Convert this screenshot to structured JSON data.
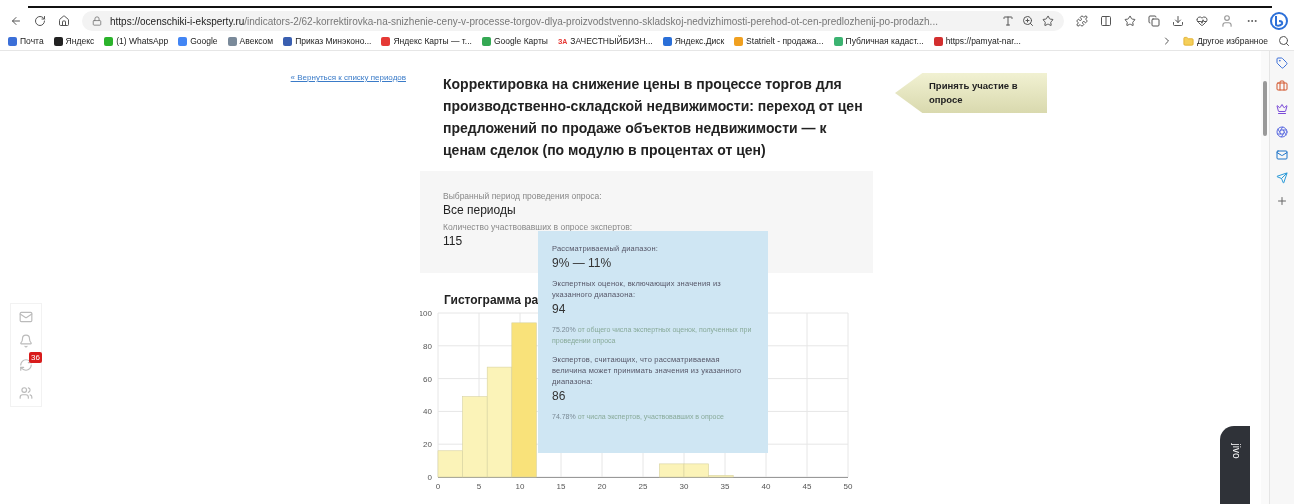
{
  "browser": {
    "url_host": "https://ocenschiki-i-eksperty.ru",
    "url_path": "/indicators-2/62-korrektirovka-na-snizhenie-ceny-v-processe-torgov-dlya-proizvodstvenno-skladskoj-nedvizhimosti-perehod-ot-cen-predlozhenij-po-prodazh...",
    "bookmarks": [
      {
        "label": "Почта",
        "color": "#3b6fd8"
      },
      {
        "label": "Яндекс",
        "color": "#222222"
      },
      {
        "label": "(1) WhatsApp",
        "color": "#2bb32b"
      },
      {
        "label": "Google",
        "color": "#4285f4"
      },
      {
        "label": "Авексом",
        "color": "#7a8a9a"
      },
      {
        "label": "Приказ Минэконо...",
        "color": "#3a5fb0"
      },
      {
        "label": "Яндекс Карты — т...",
        "color": "#e53935"
      },
      {
        "label": "Google Карты",
        "color": "#34a853"
      },
      {
        "label": "ЗАЧЕСТНЫЙБИЗН...",
        "color": "#e53935",
        "icon_text": "ЗА"
      },
      {
        "label": "Яндекс.Диск",
        "color": "#2a6fd8"
      },
      {
        "label": "Statrielt - продажа...",
        "color": "#f0a020"
      },
      {
        "label": "Публичная кадаст...",
        "color": "#3cb371"
      },
      {
        "label": "https://pamyat-nar...",
        "color": "#d32f2f"
      }
    ],
    "other_favorites": "Другое избранное"
  },
  "page": {
    "back_link": "« Вернуться к списку периодов",
    "title": "Корректировка на снижение цены в процессе торгов для производственно-складской недвижимости: переход от цен предложений по продаже объектов недвижимости — к ценам сделок (по модулю в процентах от цен)",
    "cta": "Принять участие в опросе",
    "info": [
      {
        "label": "Выбранный период проведения опроса:",
        "value": "Все периоды"
      },
      {
        "label": "Количество участвовавших в опросе экспертов:",
        "value": "115"
      }
    ],
    "histogram_title": "Гистограмма ра",
    "chart_data": {
      "type": "bar",
      "x": [
        1.5,
        4.5,
        7.5,
        10.5,
        28.5,
        31.5,
        34.5
      ],
      "series": [
        {
          "color": "#fbf3b8",
          "values": [
            16,
            49,
            67,
            null,
            8,
            8,
            1
          ]
        },
        {
          "color": "#f9e27a",
          "values": [
            null,
            null,
            null,
            94,
            null,
            null,
            null
          ]
        }
      ],
      "xlim": [
        0,
        50
      ],
      "ylim": [
        0,
        100
      ],
      "xticks": [
        0,
        5,
        10,
        15,
        20,
        25,
        30,
        35,
        40,
        45,
        50
      ],
      "yticks": [
        0,
        20,
        40,
        60,
        80,
        100
      ],
      "grid": true
    },
    "tooltip": {
      "range_label": "Рассматриваемый диапазон:",
      "range": "9% — 11%",
      "estimates_label": "Экспертных оценок, включающих значения из указанного диапазона:",
      "estimates": "94",
      "estimates_share": "75.20%",
      "estimates_note": "от общего числа экспертных оценок, полученных при проведении опроса",
      "experts_label": "Экспертов, считающих, что рассматриваемая величина может принимать значения из указанного диапазона:",
      "experts": "86",
      "experts_share": "74.78%",
      "experts_note": "от числа экспертов, участвовавших в опросе"
    }
  },
  "float_panel": {
    "badge": "36"
  },
  "chat_widget": {
    "label": "jivo"
  }
}
